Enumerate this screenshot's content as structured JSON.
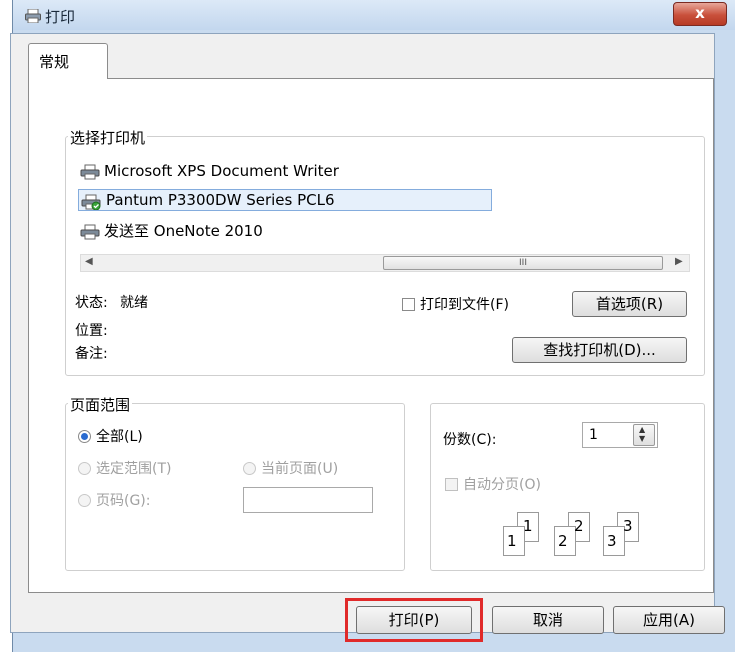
{
  "window": {
    "title": "打印",
    "close_icon": "close-icon"
  },
  "tabs": [
    {
      "label": "常规"
    }
  ],
  "select_printer": {
    "legend": "选择打印机",
    "printers": [
      {
        "name": "Microsoft XPS Document Writer",
        "icon": "printer-icon"
      },
      {
        "name": "Pantum P3300DW Series PCL6",
        "icon": "printer-default-icon",
        "selected": true
      },
      {
        "name": "发送至 OneNote 2010",
        "icon": "printer-icon"
      }
    ],
    "scroll_grip": "III",
    "status_label": "状态:",
    "status_value": "就绪",
    "location_label": "位置:",
    "comment_label": "备注:",
    "print_to_file_label": "打印到文件(F)",
    "preferences_button": "首选项(R)",
    "find_printer_button": "查找打印机(D)..."
  },
  "page_range": {
    "legend": "页面范围",
    "all_label": "全部(L)",
    "selection_label": "选定范围(T)",
    "current_page_label": "当前页面(U)",
    "pages_label": "页码(G):",
    "pages_value": ""
  },
  "copies": {
    "label": "份数(C):",
    "value": "1",
    "collate_label": "自动分页(O)",
    "collate_pages": [
      "1",
      "1",
      "2",
      "2",
      "3",
      "3"
    ]
  },
  "buttons": {
    "print": "打印(P)",
    "cancel": "取消",
    "apply": "应用(A)"
  },
  "highlight_color": "#e02a2a"
}
